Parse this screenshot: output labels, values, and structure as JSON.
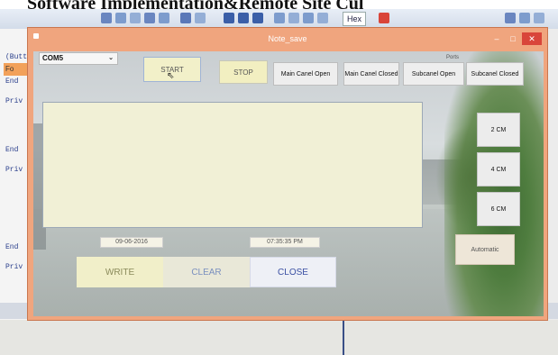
{
  "document_heading": "Software Implementation&Remote Site Cul",
  "ide": {
    "hex_label": "Hex",
    "fo_tab": "Fo",
    "left_words": [
      "(Butt",
      "End",
      "Priv",
      "End",
      "Priv",
      "End",
      "Priv"
    ]
  },
  "window": {
    "title": "Note_save",
    "minimize_glyph": "–",
    "maximize_glyph": "□",
    "close_glyph": "✕"
  },
  "controls": {
    "port_combo": {
      "value": "COM5",
      "arrow": "⌄"
    },
    "ports_caption": "Ports",
    "start_label": "START",
    "stop_label": "STOP",
    "main_canal_open_label": "Main Canel Open",
    "main_canal_closed_label": "Main Canel Closed",
    "subcanal_open_label": "Subcanel Open",
    "subcanal_closed_label": "Subcanel Closed",
    "cm_buttons": [
      "2 CM",
      "4 CM",
      "6 CM"
    ],
    "date_value": "09-06-2016",
    "time_value": "07:35:35 PM",
    "automatic_label": "Automatic",
    "write_label": "WRITE",
    "clear_label": "CLEAR",
    "close_label": "CLOSE"
  },
  "colors": {
    "window_frame": "#f0a57e",
    "close_button": "#d9453a",
    "text_area": "#f1f0d6"
  }
}
